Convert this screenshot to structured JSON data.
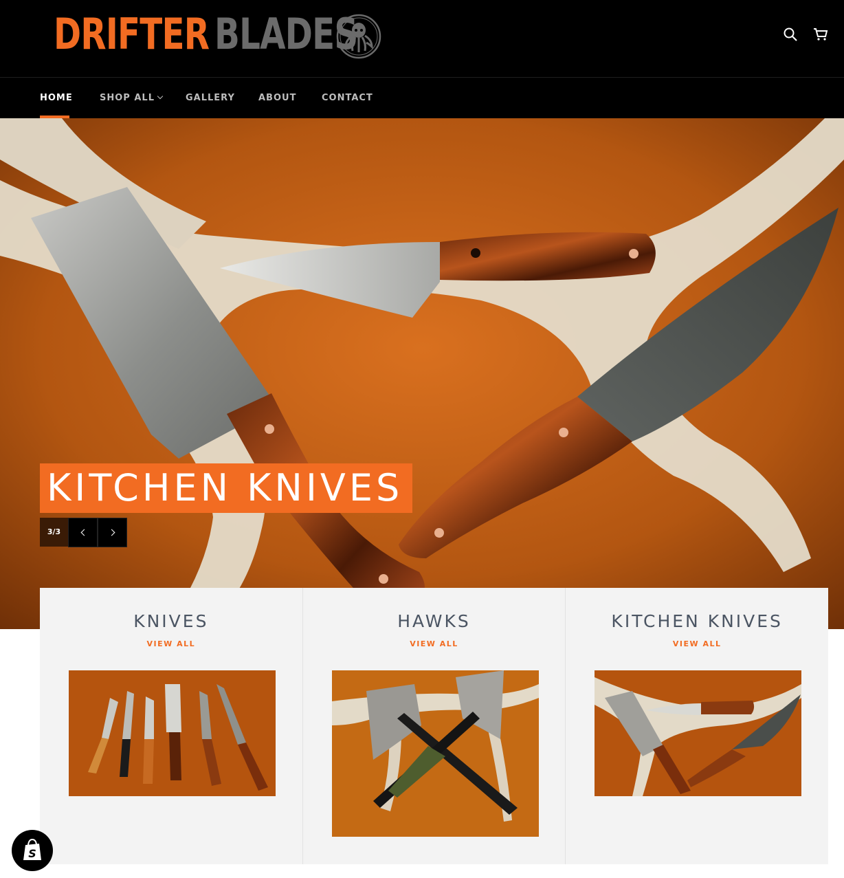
{
  "brand": {
    "name_part1": "DRIFTER",
    "name_part2": "BLADES",
    "accent_color": "#f26c22",
    "secondary_color": "#6b6b6b",
    "emblem_icon": "octopus-icon"
  },
  "header": {
    "icons": [
      "search-icon",
      "cart-icon"
    ]
  },
  "nav": {
    "items": [
      {
        "label": "HOME",
        "active": true
      },
      {
        "label": "SHOP ALL",
        "has_dropdown": true
      },
      {
        "label": "GALLERY"
      },
      {
        "label": "ABOUT"
      },
      {
        "label": "CONTACT"
      }
    ]
  },
  "hero": {
    "title": "KITCHEN KNIVES",
    "slide_counter": "3/3",
    "prev_icon": "chevron-left-icon",
    "next_icon": "chevron-right-icon"
  },
  "collections": [
    {
      "title": "KNIVES",
      "link": "VIEW ALL"
    },
    {
      "title": "HAWKS",
      "link": "VIEW ALL"
    },
    {
      "title": "KITCHEN KNIVES",
      "link": "VIEW ALL"
    }
  ],
  "badge": {
    "icon": "shopify-bag-icon"
  }
}
